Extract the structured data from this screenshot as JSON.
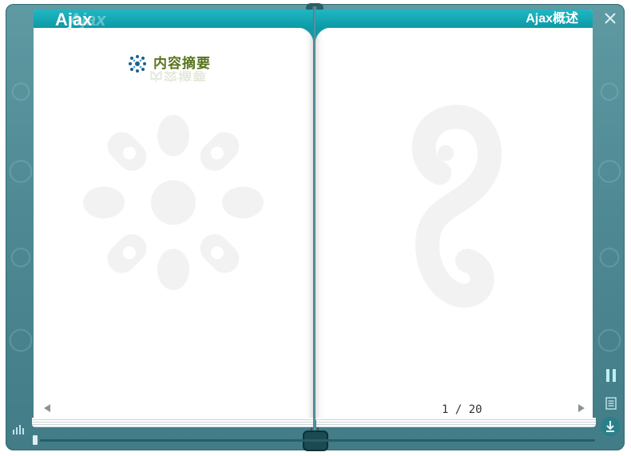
{
  "book": {
    "left_header": "Ajax",
    "right_header": "Ajax概述"
  },
  "left_page": {
    "section_title": "内容摘要",
    "prev_label": "previous page"
  },
  "right_page": {
    "page_indicator": "1 / 20"
  },
  "controls": {
    "close": "close-icon",
    "pause": "pause-icon",
    "toc": "list-icon",
    "download": "download-icon",
    "audio": "equalizer-icon"
  },
  "colors": {
    "frame": "#4f8a94",
    "banner": "#0d9aa6",
    "section_title": "#58741d",
    "watermark": "#f1f1f1"
  }
}
